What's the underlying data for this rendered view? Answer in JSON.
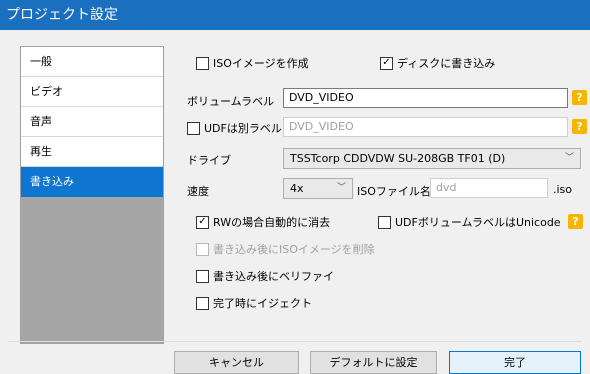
{
  "window": {
    "title": "プロジェクト設定"
  },
  "sidebar": {
    "items": [
      {
        "label": "一般"
      },
      {
        "label": "ビデオ"
      },
      {
        "label": "音声"
      },
      {
        "label": "再生"
      },
      {
        "label": "書き込み",
        "selected": true
      }
    ]
  },
  "form": {
    "create_iso": {
      "label": "ISOイメージを作成",
      "checked": false
    },
    "write_disc": {
      "label": "ディスクに書き込み",
      "checked": true
    },
    "volume_label": {
      "label": "ボリュームラベル",
      "value": "DVD_VIDEO"
    },
    "udf_label": {
      "label": "UDFは別ラベル",
      "checked": false,
      "value": "DVD_VIDEO"
    },
    "drive": {
      "label": "ドライブ",
      "value": "TSSTcorp CDDVDW SU-208GB TF01 (D)"
    },
    "speed": {
      "label": "速度",
      "value": "4x"
    },
    "iso_filename": {
      "label": "ISOファイル名",
      "value": "dvd",
      "ext": ".iso"
    },
    "rw_erase": {
      "label": "RWの場合自動的に消去",
      "checked": true
    },
    "udf_unicode": {
      "label": "UDFボリュームラベルはUnicode",
      "checked": false
    },
    "delete_iso": {
      "label": "書き込み後にISOイメージを削除",
      "checked": false,
      "disabled": true
    },
    "verify": {
      "label": "書き込み後にベリファイ",
      "checked": false
    },
    "eject": {
      "label": "完了時にイジェクト",
      "checked": false
    },
    "help_symbol": "?"
  },
  "buttons": {
    "cancel": "キャンセル",
    "default": "デフォルトに設定",
    "done": "完了"
  },
  "colors": {
    "accent": "#0e75d0",
    "title_bar": "#1a6fbf",
    "help": "#f7b500"
  }
}
